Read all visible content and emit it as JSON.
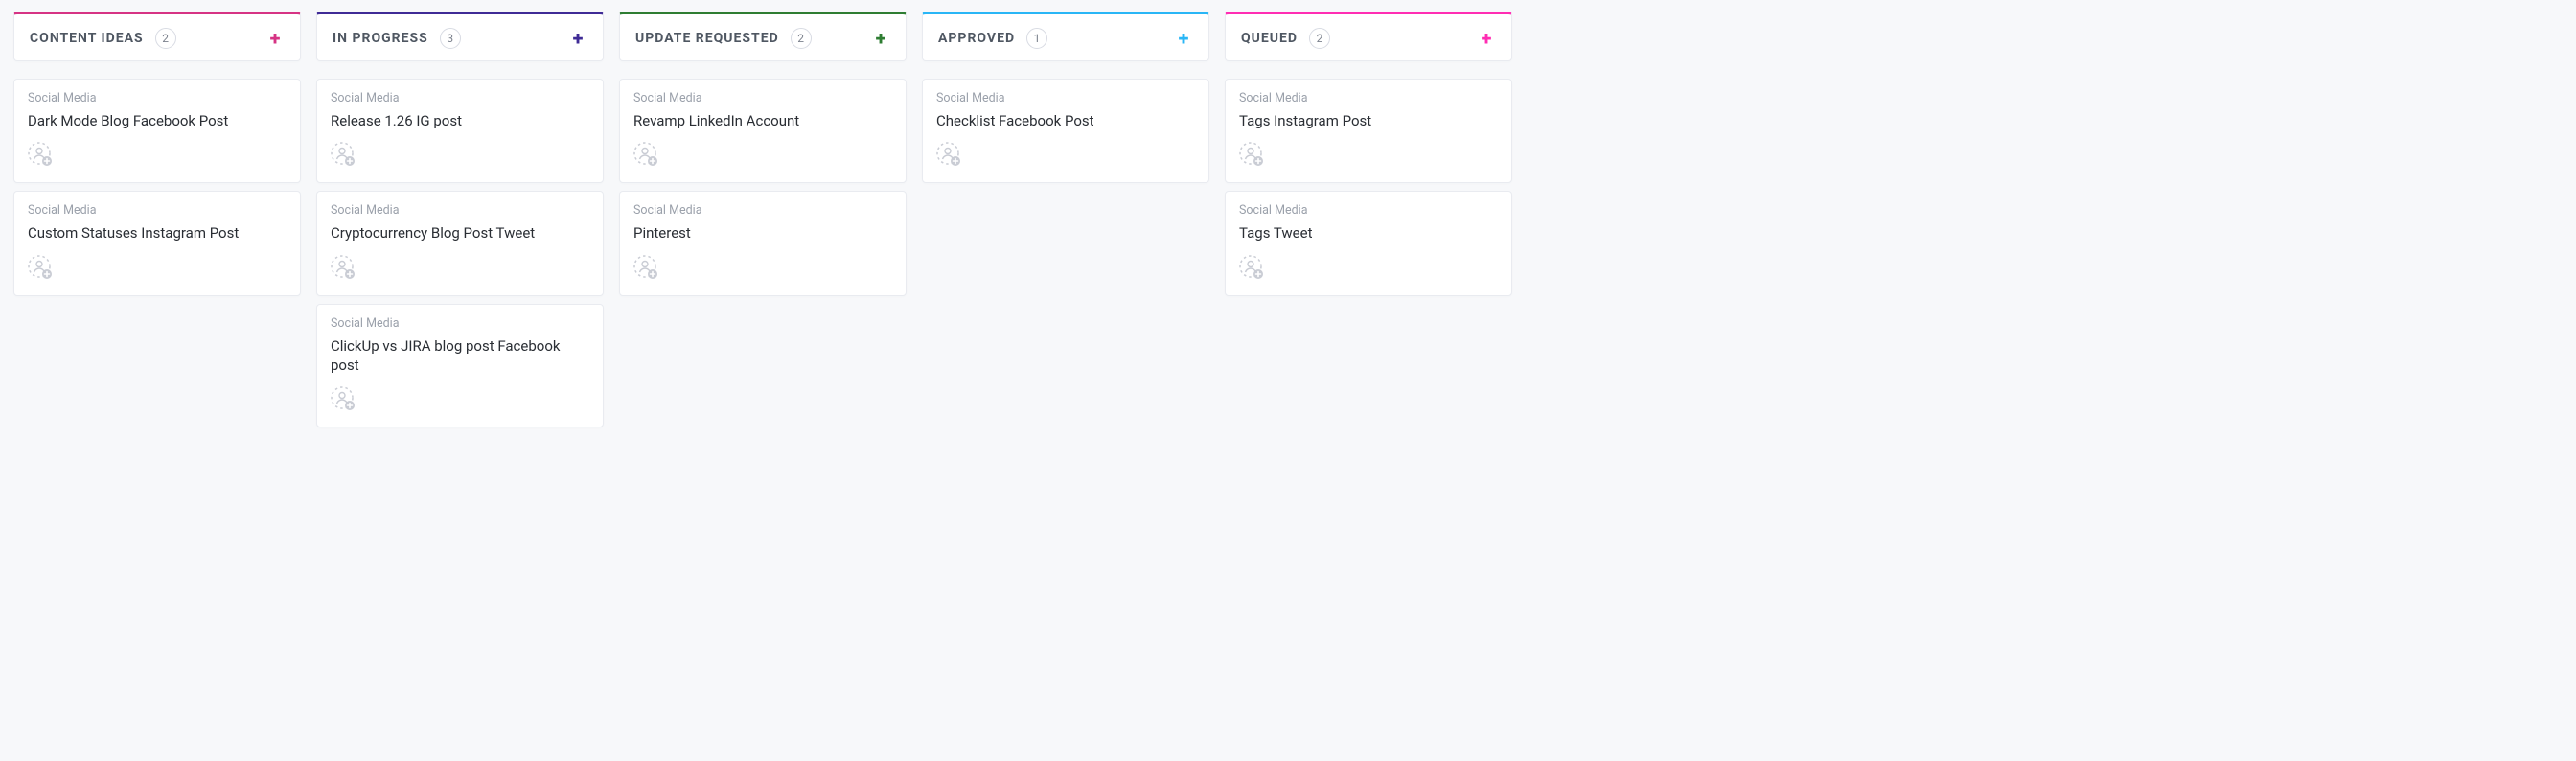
{
  "category_label": "Social Media",
  "columns": [
    {
      "title": "CONTENT IDEAS",
      "count": 2,
      "accent": "#d63384",
      "add_color": "#d63384",
      "cards": [
        {
          "title": "Dark Mode Blog Facebook Post"
        },
        {
          "title": "Custom Statuses Instagram Post"
        }
      ]
    },
    {
      "title": "IN PROGRESS",
      "count": 3,
      "accent": "#3f2b96",
      "add_color": "#3f2b96",
      "cards": [
        {
          "title": "Release 1.26 IG post"
        },
        {
          "title": "Cryptocurrency Blog Post Tweet"
        },
        {
          "title": "ClickUp vs JIRA blog post Facebook post"
        }
      ]
    },
    {
      "title": "UPDATE REQUESTED",
      "count": 2,
      "accent": "#2e7d32",
      "add_color": "#2e7d32",
      "cards": [
        {
          "title": "Revamp LinkedIn Account"
        },
        {
          "title": "Pinterest"
        }
      ]
    },
    {
      "title": "APPROVED",
      "count": 1,
      "accent": "#29b6f6",
      "add_color": "#29b6f6",
      "cards": [
        {
          "title": "Checklist Facebook Post"
        }
      ]
    },
    {
      "title": "QUEUED",
      "count": 2,
      "accent": "#ff2db3",
      "add_color": "#ff2db3",
      "cards": [
        {
          "title": "Tags Instagram Post"
        },
        {
          "title": "Tags Tweet"
        }
      ]
    }
  ]
}
